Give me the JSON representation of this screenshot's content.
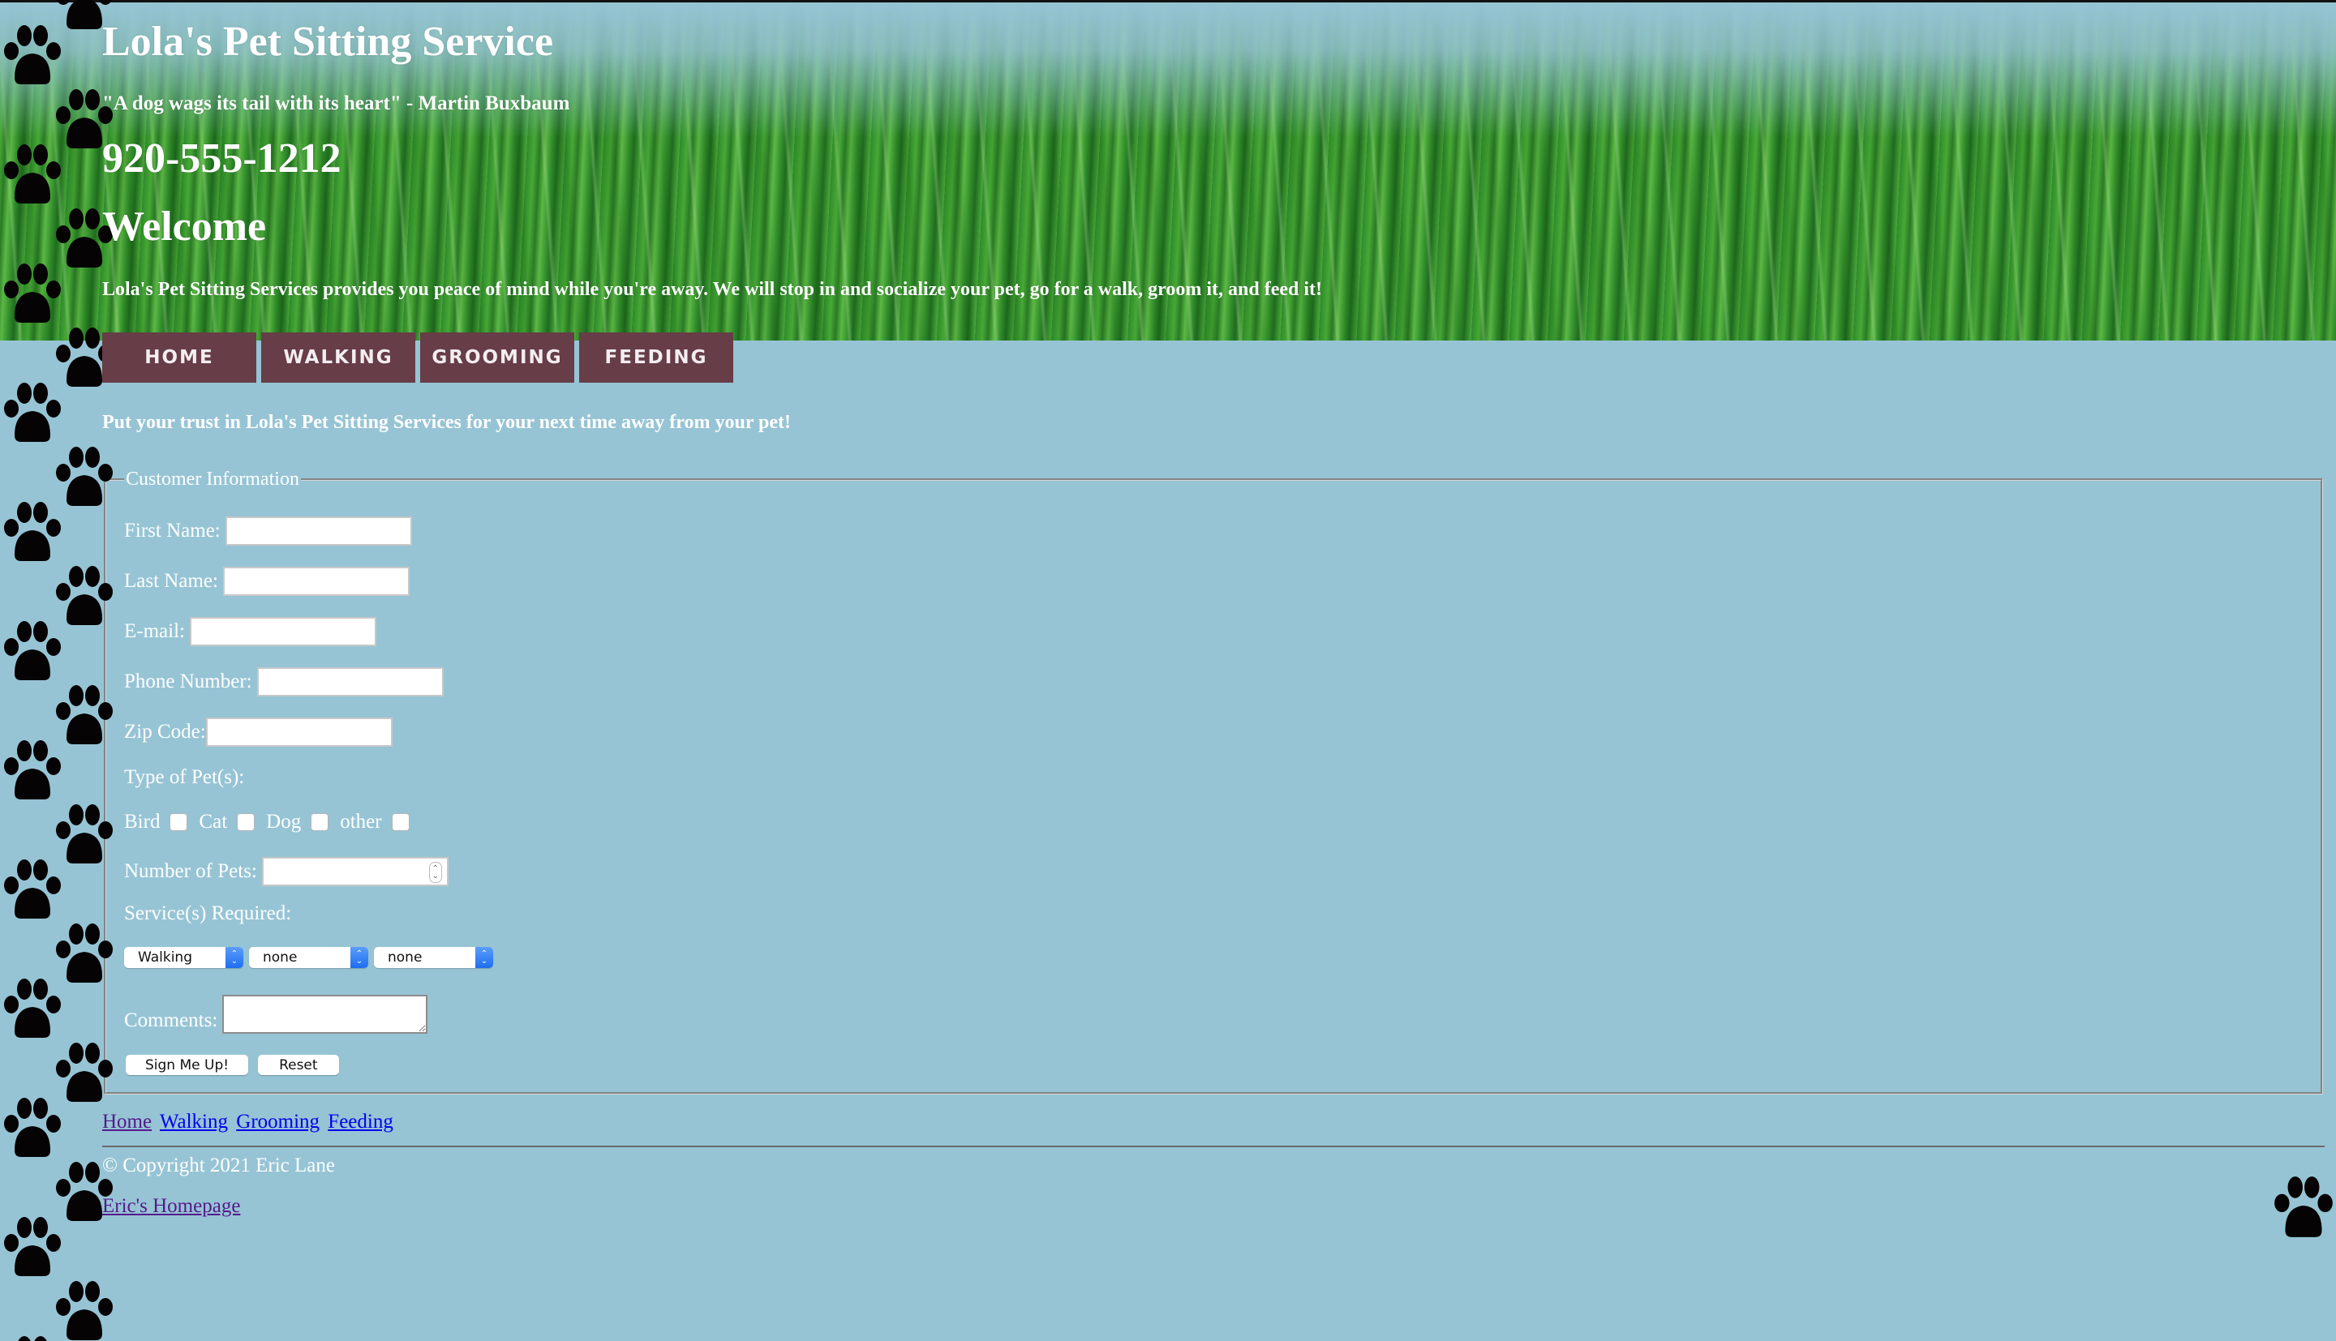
{
  "header": {
    "title": "Lola's Pet Sitting Service",
    "quote": "\"A dog wags its tail with its heart\" - Martin Buxbaum",
    "phone": "920-555-1212",
    "welcome": "Welcome",
    "intro": "Lola's Pet Sitting Services provides you peace of mind while you're away. We will stop in and socialize your pet, go for a walk, groom it, and feed it!"
  },
  "nav": {
    "items": [
      {
        "label": "HOME"
      },
      {
        "label": "WALKING"
      },
      {
        "label": "GROOMING"
      },
      {
        "label": "FEEDING"
      }
    ],
    "color": "#673d47"
  },
  "trust_text": "Put your trust in Lola's Pet Sitting Services for your next time away from your pet!",
  "form": {
    "legend": "Customer Information",
    "first_name": {
      "label": "First Name:",
      "value": ""
    },
    "last_name": {
      "label": "Last Name:",
      "value": ""
    },
    "email": {
      "label": "E-mail:",
      "value": ""
    },
    "phone": {
      "label": "Phone Number:",
      "value": ""
    },
    "zip": {
      "label": "Zip Code:",
      "value": ""
    },
    "pet_type_label": "Type of Pet(s):",
    "pets": [
      {
        "label": "Bird",
        "checked": false
      },
      {
        "label": "Cat",
        "checked": false
      },
      {
        "label": "Dog",
        "checked": false
      },
      {
        "label": "other",
        "checked": false
      }
    ],
    "number_of_pets": {
      "label": "Number of Pets:",
      "value": ""
    },
    "services_label": "Service(s) Required:",
    "services": [
      {
        "selected": "Walking"
      },
      {
        "selected": "none"
      },
      {
        "selected": "none"
      }
    ],
    "comments": {
      "label": "Comments:",
      "value": ""
    },
    "submit_label": "Sign Me Up!",
    "reset_label": "Reset"
  },
  "footer": {
    "links": [
      {
        "label": "Home",
        "visited": true
      },
      {
        "label": "Walking",
        "visited": false
      },
      {
        "label": "Grooming",
        "visited": false
      },
      {
        "label": "Feeding",
        "visited": false
      }
    ],
    "copyright": "© Copyright 2021 Eric Lane",
    "homepage_link": "Eric's Homepage"
  },
  "colors": {
    "background": "#96c4d5",
    "nav_button": "#673d47",
    "link": "#0000ee",
    "visited_link": "#551a8b",
    "select_accent": "#2a78f4"
  }
}
